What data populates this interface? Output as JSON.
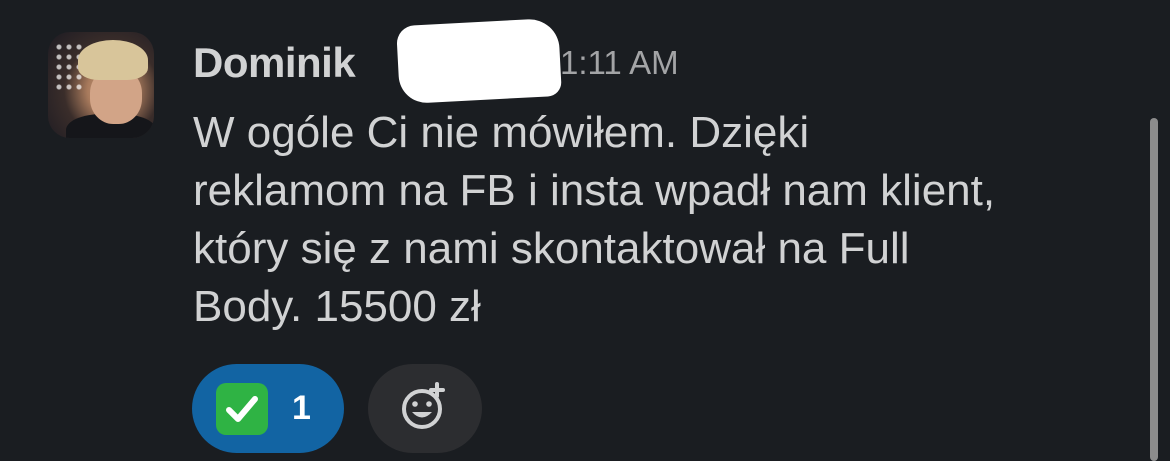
{
  "message": {
    "author": "Dominik",
    "timestamp": "1:11 AM",
    "text": "W ogóle Ci nie mówiłem. Dzięki\nreklamom na FB i insta wpadł nam klient,\nktóry się z nami skontaktował na Full\nBody. 15500 zł"
  },
  "reactions": [
    {
      "emoji": "white-check-mark",
      "count": "1",
      "color": "#1264a3"
    }
  ],
  "add_reaction": {
    "icon": "add-emoji-icon"
  },
  "colors": {
    "background": "#1a1d21",
    "text": "#d1d2d3",
    "timestamp": "#a3a4a6",
    "reaction_active": "#1264a3",
    "reaction_inactive": "#2c2d30"
  }
}
